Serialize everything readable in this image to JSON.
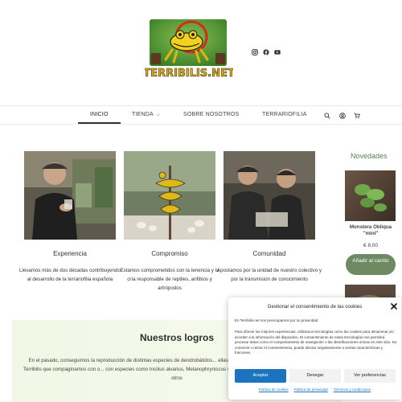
{
  "header": {
    "logo_text": "TERRIBILIS.NET",
    "social_icons": [
      "instagram-icon",
      "facebook-icon",
      "youtube-icon"
    ]
  },
  "nav": {
    "items": [
      {
        "label": "INICIO",
        "active": true
      },
      {
        "label": "TIENDA",
        "has_dropdown": true
      },
      {
        "label": "SOBRE NOSOTROS"
      },
      {
        "label": "TERRARIOFILIA"
      }
    ],
    "icons": [
      "search-icon",
      "account-icon",
      "cart-icon"
    ]
  },
  "features": [
    {
      "title": "Experiencia",
      "text": "Llevamos más de dos décadas contribuyendo al desarrollo de la terrariofilia española"
    },
    {
      "title": "Compromiso",
      "text": "Estamos comprometidos con la tenencia y la cría responsable de reptiles, anfibios y artrópodos"
    },
    {
      "title": "Comunidad",
      "text": "Apostamos por la unidad de nuestro colectivo y por la transmisión de conocimiento"
    }
  ],
  "sidebar": {
    "title": "Novedades",
    "product_name": "Monstera Obliqua \"mini\"",
    "product_price": "€ 8,00",
    "button_label": "Añadir al carrito"
  },
  "logros": {
    "title": "Nuestros logros",
    "text": "En el pasado, conseguimos la reproducción de distintas especies de dendrobátidos... ellas en nuestro país. Proyectos aún vigentes en Terribilis que compaginamos con o... con especies como Incilius alvarius, Melanophryniscus stelzneri, Morelia viridis, Varan... entre muchos otros"
  },
  "cookie": {
    "title": "Gestionar el consentimiento de las cookies",
    "line1": "En Terribilis.net nos preocupamos por su privacidad",
    "body": "Para ofrecer las mejores experiencias, utilizamos tecnologías como las cookies para almacenar y/o acceder a la información del dispositivo. El consentimiento de estas tecnologías nos permitirá procesar datos como el comportamiento de navegación o las identificaciones únicas en este sitio. No consentir o retirar el consentimiento, puede afectar negativamente a ciertas características y funciones.",
    "accept_label": "Aceptar",
    "deny_label": "Denegar",
    "prefs_label": "Ver preferencias",
    "links": [
      "Política de cookies",
      "Política de privacidad",
      "Términos y condiciones"
    ]
  },
  "colors": {
    "accent_green": "#6f8a63",
    "cookie_blue": "#1e73be",
    "band_bg": "#f3f8e8"
  }
}
